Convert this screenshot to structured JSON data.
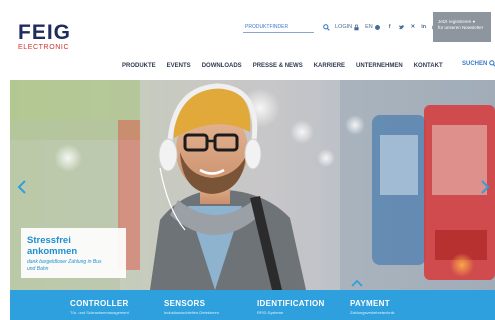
{
  "logo": {
    "main": "FEIG",
    "sub": "ELECTRONIC"
  },
  "topbar": {
    "product_finder": "PRODUKTFINDER",
    "login": "LOGIN",
    "language": "EN",
    "social_icons": [
      "facebook-icon",
      "twitter-icon",
      "xing-icon",
      "linkedin-icon",
      "youtube-icon"
    ]
  },
  "newsletter": {
    "line1": "Jetzt registrieren",
    "line2": "für unseren Newsletter"
  },
  "nav": {
    "items": [
      "PRODUKTE",
      "EVENTS",
      "DOWNLOADS",
      "PRESSE & NEWS",
      "KARRIERE",
      "UNTERNEHMEN",
      "KONTAKT"
    ],
    "search": "SUCHEN"
  },
  "hero": {
    "title": "Stressfrei ankommen",
    "subtitle": "dank bargeldloser Zahlung in Bus und Bahn"
  },
  "categories": [
    {
      "title": "CONTROLLER",
      "sub": "Tür- und Schrankenmanagement"
    },
    {
      "title": "SENSORS",
      "sub": "Induktionsschleifen-Detektoren"
    },
    {
      "title": "IDENTIFICATION",
      "sub": "RFID-Systeme"
    },
    {
      "title": "PAYMENT",
      "sub": "Zahlungsverkehrstechnik"
    }
  ],
  "colors": {
    "brand_navy": "#1f2b5c",
    "brand_red": "#d32f2f",
    "accent_blue": "#2ea0dd"
  }
}
